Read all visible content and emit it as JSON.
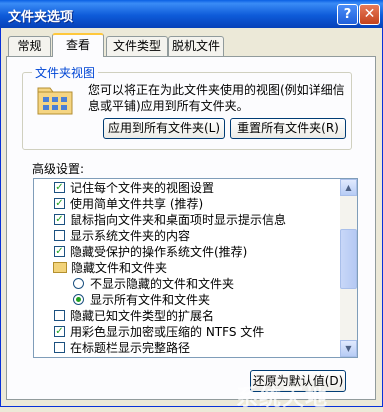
{
  "window": {
    "title": "文件夹选项",
    "help_label": "?",
    "close_label": "✕"
  },
  "tabs": [
    {
      "label": "常规"
    },
    {
      "label": "查看"
    },
    {
      "label": "文件类型"
    },
    {
      "label": "脱机文件"
    }
  ],
  "folder_views": {
    "group_title": "文件夹视图",
    "description": "您可以将正在为此文件夹使用的视图(例如详细信息或平铺)应用到所有文件夹。",
    "apply_all_label": "应用到所有文件夹(L)",
    "reset_all_label": "重置所有文件夹(R)",
    "icon": "folder-views-icon"
  },
  "advanced": {
    "label": "高级设置:",
    "items": [
      {
        "type": "checkbox",
        "checked": true,
        "label": "记住每个文件夹的视图设置"
      },
      {
        "type": "checkbox",
        "checked": true,
        "label": "使用简单文件共享 (推荐)"
      },
      {
        "type": "checkbox",
        "checked": true,
        "label": "鼠标指向文件夹和桌面项时显示提示信息"
      },
      {
        "type": "checkbox",
        "checked": false,
        "label": "显示系统文件夹的内容"
      },
      {
        "type": "checkbox",
        "checked": true,
        "label": "隐藏受保护的操作系统文件(推荐)"
      },
      {
        "type": "folder",
        "label": "隐藏文件和文件夹"
      },
      {
        "type": "radio",
        "checked": false,
        "label": "不显示隐藏的文件和文件夹"
      },
      {
        "type": "radio",
        "checked": true,
        "label": "显示所有文件和文件夹"
      },
      {
        "type": "checkbox",
        "checked": false,
        "label": "隐藏已知文件类型的扩展名"
      },
      {
        "type": "checkbox",
        "checked": true,
        "label": "用彩色显示加密或压缩的 NTFS 文件"
      },
      {
        "type": "checkbox",
        "checked": false,
        "label": "在标题栏显示完整路径"
      }
    ],
    "scroll_up": "▲",
    "scroll_down": "▼"
  },
  "footer": {
    "restore_defaults_label": "还原为默认值(D)"
  },
  "watermark": "系统天地"
}
